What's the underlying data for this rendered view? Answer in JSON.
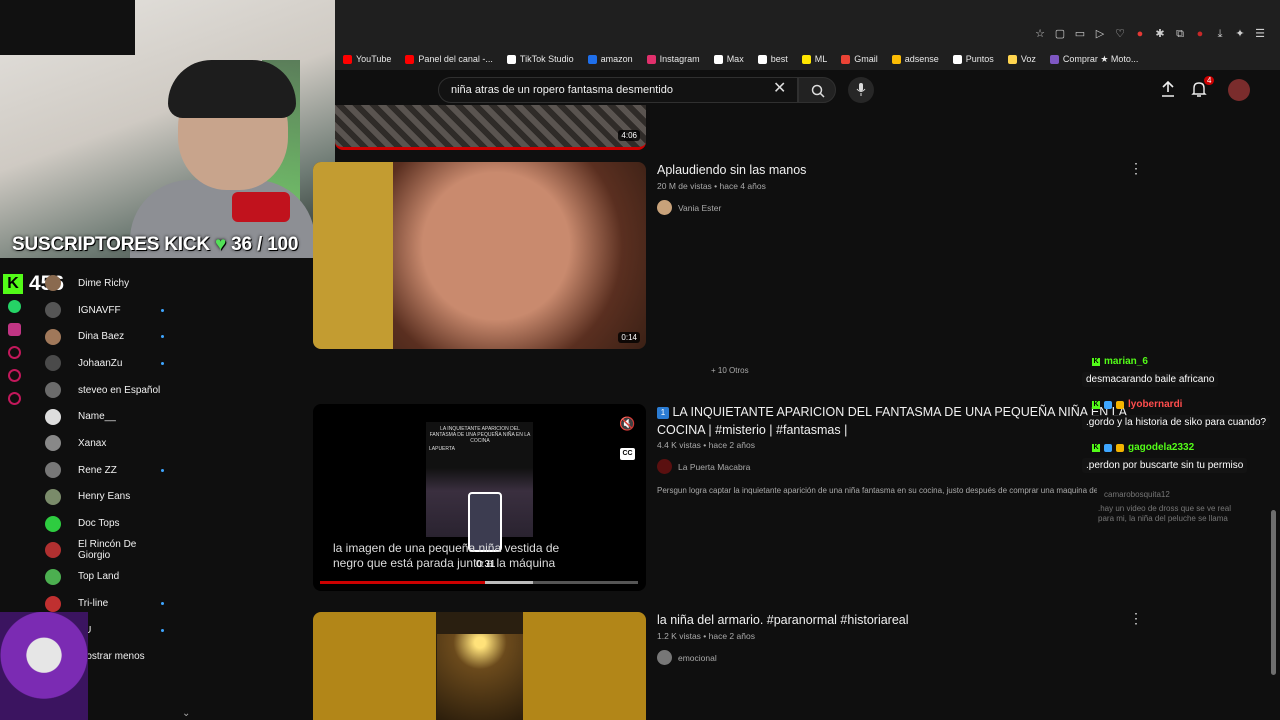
{
  "bookmarks": [
    "YouTube",
    "Panel del canal -...",
    "TikTok Studio",
    "amazon",
    "Instagram",
    "Max",
    "best",
    "ML",
    "Gmail",
    "adsense",
    "Puntos",
    "Voz",
    "Comprar ★ Moto..."
  ],
  "bookmark_colors": [
    "#ff0000",
    "#ff0000",
    "#ffffff",
    "#1f6feb",
    "#e1306c",
    "#ffffff",
    "#ffffff",
    "#ffe600",
    "#ea4335",
    "#fbbc04",
    "#ffffff",
    "#ffd54f",
    "#7e57c2"
  ],
  "search": {
    "value": "niña atras de un ropero fantasma desmentido"
  },
  "header": {
    "notification_count": "4"
  },
  "stream": {
    "subs_label": "SUSCRIPTORES KICK",
    "subs_count": "36 / 100",
    "kick_viewers": "456"
  },
  "subscriptions": [
    {
      "name": "Dime Richy",
      "dot": false,
      "color": "#8a6a4f"
    },
    {
      "name": "IGNAVFF",
      "dot": true,
      "color": "#555"
    },
    {
      "name": "Dina Baez",
      "dot": true,
      "color": "#a0785a"
    },
    {
      "name": "JohaanZu",
      "dot": true,
      "color": "#4a4a4a"
    },
    {
      "name": "steveo en Español",
      "dot": false,
      "color": "#6b6b6b"
    },
    {
      "name": "Name__",
      "dot": false,
      "color": "#ddd"
    },
    {
      "name": "Xanax",
      "dot": false,
      "color": "#888"
    },
    {
      "name": "Rene ZZ",
      "dot": true,
      "color": "#777"
    },
    {
      "name": "Henry Eans",
      "dot": false,
      "color": "#7a8b6a"
    },
    {
      "name": "Doc Tops",
      "dot": false,
      "color": "#2ecc40"
    },
    {
      "name": "El Rincón De Giorgio",
      "dot": false,
      "color": "#b03030"
    },
    {
      "name": "Top Land",
      "dot": false,
      "color": "#4caf50"
    },
    {
      "name": "Tri-line",
      "dot": true,
      "color": "#c03030"
    },
    {
      "name": "FU",
      "dot": true,
      "color": "#333"
    },
    {
      "name": "Mostrar menos",
      "dot": false,
      "color": "transparent"
    }
  ],
  "videos": {
    "top_duration": "4:06",
    "v1": {
      "title": "Aplaudiendo sin las manos",
      "meta": "20 M de vistas • hace 4 años",
      "channel": "Vania Ester",
      "duration": "0:14"
    },
    "more_label": "+ 10 Otros",
    "v2": {
      "title": "LA INQUIETANTE APARICION DEL FANTASMA DE UNA PEQUEÑA NIÑA EN LA",
      "title_line2": "COCINA | #misterio | #fantasmas |",
      "meta": "4.4 K vistas • hace 2 años",
      "channel": "La Puerta Macabra",
      "description": "Persgun logra captar la inquietante aparición de una niña fantasma en su cocina, justo después de comprar una maquina de ...",
      "thumb_text": "LA INQUIETANTE APARICION DEL FANTASMA DE UNA PEQUEÑA NIÑA EN LA COCINA",
      "thumb_sub": "LAPUERTA",
      "caption": "la imagen de una pequeña niña vestida de negro que está parada junto a la máquina",
      "time": "0:31",
      "cc": "CC",
      "progress": 0.52
    },
    "v3": {
      "title": "la niña del armario. #paranormal #historiareal",
      "meta": "1.2 K vistas • hace 2 años",
      "channel": "emocional"
    }
  },
  "chat": [
    {
      "user": "marian_6",
      "user_color": "#53fc18",
      "msg": "desmacarando baile africano"
    },
    {
      "user": "lyobernardi",
      "user_color": "#ff4d4d",
      "msg": ".gordo y la historia de siko para cuando?"
    },
    {
      "user": "gagodela2332",
      "user_color": "#53fc18",
      "msg": ".perdon por buscarte sin tu permiso"
    }
  ],
  "chat_faded": {
    "user": "camarobosquita12",
    "msg": ".hay un video de dross que se ve real para mi, la niña del peluche se llama"
  }
}
